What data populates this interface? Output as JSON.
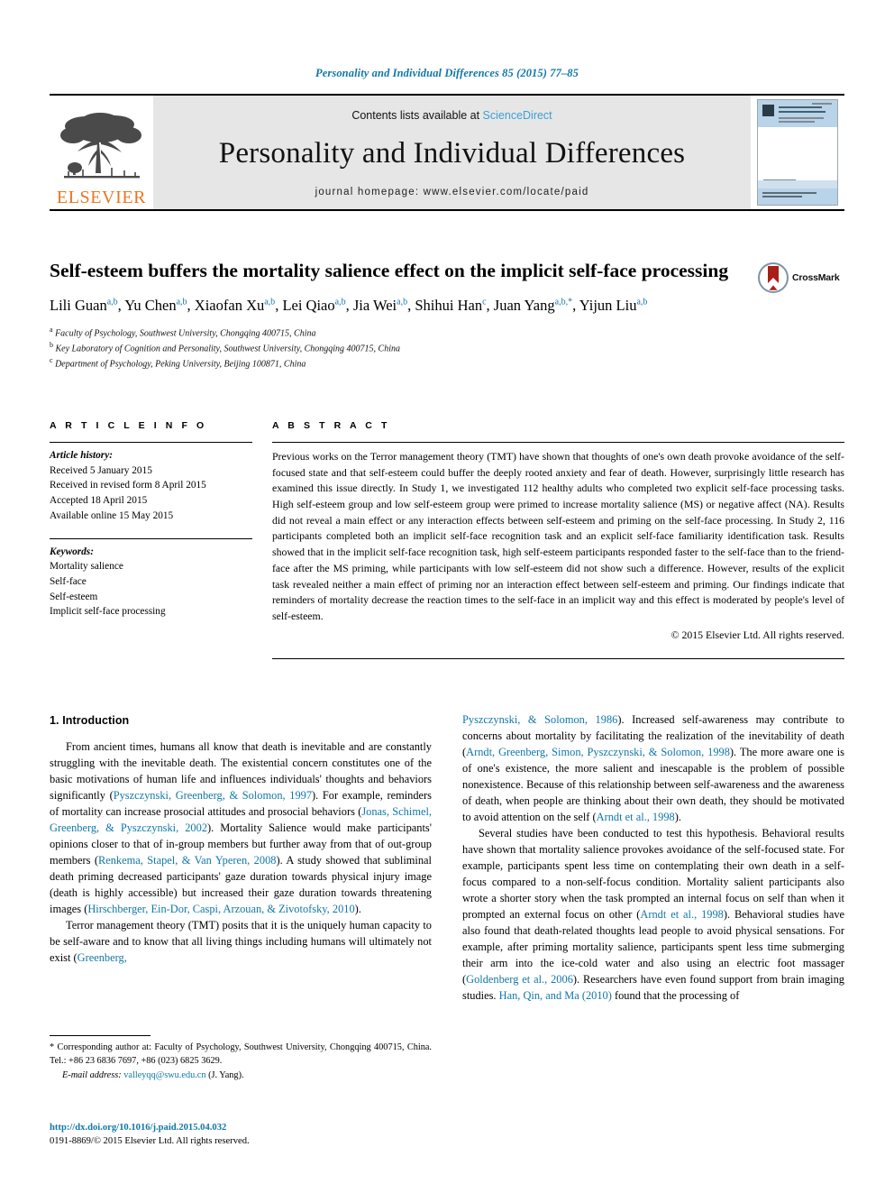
{
  "running_head": "Personality and Individual Differences 85 (2015) 77–85",
  "masthead": {
    "publisher": "ELSEVIER",
    "contents_prefix": "Contents lists available at ",
    "contents_link": "ScienceDirect",
    "journal_title": "Personality and Individual Differences",
    "homepage": "journal homepage: www.elsevier.com/locate/paid",
    "cover_alt": "Personality and Individual Differences journal cover"
  },
  "article": {
    "title": "Self-esteem buffers the mortality salience effect on the implicit self-face processing",
    "crossmark_label": "CrossMark",
    "authors": [
      {
        "name": "Lili Guan",
        "sup": "a,b"
      },
      {
        "name": "Yu Chen",
        "sup": "a,b"
      },
      {
        "name": "Xiaofan Xu",
        "sup": "a,b"
      },
      {
        "name": "Lei Qiao",
        "sup": "a,b"
      },
      {
        "name": "Jia Wei",
        "sup": "a,b"
      },
      {
        "name": "Shihui Han",
        "sup": "c"
      },
      {
        "name": "Juan Yang",
        "sup": "a,b,*"
      },
      {
        "name": "Yijun Liu",
        "sup": "a,b"
      }
    ],
    "affiliations": [
      {
        "mark": "a",
        "text": "Faculty of Psychology, Southwest University, Chongqing 400715, China"
      },
      {
        "mark": "b",
        "text": "Key Laboratory of Cognition and Personality, Southwest University, Chongqing 400715, China"
      },
      {
        "mark": "c",
        "text": "Department of Psychology, Peking University, Beijing 100871, China"
      }
    ]
  },
  "article_info": {
    "heading": "A R T I C L E   I N F O",
    "history_label": "Article history:",
    "history": [
      "Received 5 January 2015",
      "Received in revised form 8 April 2015",
      "Accepted 18 April 2015",
      "Available online 15 May 2015"
    ],
    "keywords_label": "Keywords:",
    "keywords": [
      "Mortality salience",
      "Self-face",
      "Self-esteem",
      "Implicit self-face processing"
    ]
  },
  "abstract": {
    "heading": "A B S T R A C T",
    "text": "Previous works on the Terror management theory (TMT) have shown that thoughts of one's own death provoke avoidance of the self-focused state and that self-esteem could buffer the deeply rooted anxiety and fear of death. However, surprisingly little research has examined this issue directly. In Study 1, we investigated 112 healthy adults who completed two explicit self-face processing tasks. High self-esteem group and low self-esteem group were primed to increase mortality salience (MS) or negative affect (NA). Results did not reveal a main effect or any interaction effects between self-esteem and priming on the self-face processing. In Study 2, 116 participants completed both an implicit self-face recognition task and an explicit self-face familiarity identification task. Results showed that in the implicit self-face recognition task, high self-esteem participants responded faster to the self-face than to the friend-face after the MS priming, while participants with low self-esteem did not show such a difference. However, results of the explicit task revealed neither a main effect of priming nor an interaction effect between self-esteem and priming. Our findings indicate that reminders of mortality decrease the reaction times to the self-face in an implicit way and this effect is moderated by people's level of self-esteem.",
    "copyright": "© 2015 Elsevier Ltd. All rights reserved."
  },
  "body": {
    "section_heading": "1. Introduction",
    "left_paragraphs": [
      {
        "parts": [
          {
            "t": "From ancient times, humans all know that death is inevitable and are constantly struggling with the inevitable death. The existential concern constitutes one of the basic motivations of human life and influences individuals' thoughts and behaviors significantly (",
            "link": false
          },
          {
            "t": "Pyszczynski, Greenberg, & Solomon, 1997",
            "link": true
          },
          {
            "t": "). For example, reminders of mortality can increase prosocial attitudes and prosocial behaviors (",
            "link": false
          },
          {
            "t": "Jonas, Schimel, Greenberg, & Pyszczynski, 2002",
            "link": true
          },
          {
            "t": "). Mortality Salience would make participants' opinions closer to that of in-group members but further away from that of out-group members (",
            "link": false
          },
          {
            "t": "Renkema, Stapel, & Van Yperen, 2008",
            "link": true
          },
          {
            "t": "). A study showed that subliminal death priming decreased participants' gaze duration towards physical injury image (death is highly accessible) but increased their gaze duration towards threatening images (",
            "link": false
          },
          {
            "t": "Hirschberger, Ein-Dor, Caspi, Arzouan, & Zivotofsky, 2010",
            "link": true
          },
          {
            "t": ").",
            "link": false
          }
        ],
        "indent": true
      },
      {
        "parts": [
          {
            "t": "Terror management theory (TMT) posits that it is the uniquely human capacity to be self-aware and to know that all living things including humans will ultimately not exist (",
            "link": false
          },
          {
            "t": "Greenberg,",
            "link": true
          }
        ],
        "indent": true
      }
    ],
    "right_paragraphs": [
      {
        "parts": [
          {
            "t": "Pyszczynski, & Solomon, 1986",
            "link": true
          },
          {
            "t": "). Increased self-awareness may contribute to concerns about mortality by facilitating the realization of the inevitability of death (",
            "link": false
          },
          {
            "t": "Arndt, Greenberg, Simon, Pyszczynski, & Solomon, 1998",
            "link": true
          },
          {
            "t": "). The more aware one is of one's existence, the more salient and inescapable is the problem of possible nonexistence. Because of this relationship between self-awareness and the awareness of death, when people are thinking about their own death, they should be motivated to avoid attention on the self (",
            "link": false
          },
          {
            "t": "Arndt et al., 1998",
            "link": true
          },
          {
            "t": ").",
            "link": false
          }
        ],
        "indent": false
      },
      {
        "parts": [
          {
            "t": "Several studies have been conducted to test this hypothesis. Behavioral results have shown that mortality salience provokes avoidance of the self-focused state. For example, participants spent less time on contemplating their own death in a self-focus compared to a non-self-focus condition. Mortality salient participants also wrote a shorter story when the task prompted an internal focus on self than when it prompted an external focus on other (",
            "link": false
          },
          {
            "t": "Arndt et al., 1998",
            "link": true
          },
          {
            "t": "). Behavioral studies have also found that death-related thoughts lead people to avoid physical sensations. For example, after priming mortality salience, participants spent less time submerging their arm into the ice-cold water and also using an electric foot massager (",
            "link": false
          },
          {
            "t": "Goldenberg et al., 2006",
            "link": true
          },
          {
            "t": "). Researchers have even found support from brain imaging studies. ",
            "link": false
          },
          {
            "t": "Han, Qin, and Ma (2010)",
            "link": true
          },
          {
            "t": " found that the processing of",
            "link": false
          }
        ],
        "indent": true
      }
    ]
  },
  "footnote": {
    "corresponding": "* Corresponding author at: Faculty of Psychology, Southwest University, Chongqing 400715, China. Tel.: +86 23 6836 7697, +86 (023) 6825 3629.",
    "email_label": "E-mail address:",
    "email": "valleyqq@swu.edu.cn",
    "email_owner": "(J. Yang).",
    "doi": "http://dx.doi.org/10.1016/j.paid.2015.04.032",
    "issn": "0191-8869/© 2015 Elsevier Ltd. All rights reserved."
  },
  "colors": {
    "link": "#1177a8",
    "elsevier_orange": "#e87722",
    "band_gray": "#e6e6e6",
    "cover_blue": "#b9d3e8"
  }
}
